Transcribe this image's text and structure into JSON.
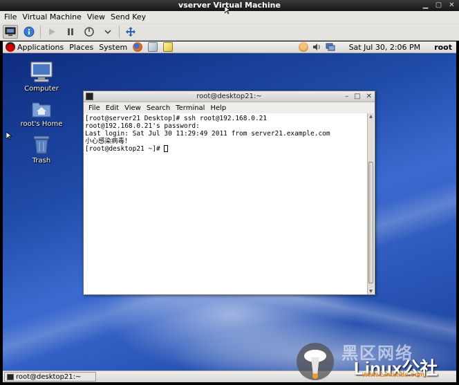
{
  "host_window": {
    "title": "vserver Virtual Machine",
    "controls": [
      "minimize-icon",
      "maximize-icon",
      "close-icon"
    ]
  },
  "host_menu": [
    "File",
    "Virtual Machine",
    "View",
    "Send Key"
  ],
  "host_toolbar": {
    "buttons": [
      "console-icon",
      "details-info-icon",
      "run-icon",
      "pause-icon",
      "shutdown-icon",
      "dropdown-chevron-icon",
      "fullscreen-icon"
    ],
    "active": "console-icon"
  },
  "gnome_panel": {
    "menus": [
      "Applications",
      "Places",
      "System"
    ],
    "launchers": [
      "firefox-icon",
      "mail-icon",
      "notes-icon"
    ],
    "tray": [
      "user-status-icon",
      "volume-icon",
      "network-icon"
    ],
    "clock": "Sat Jul 30,  2:06 PM",
    "user": "root"
  },
  "desktop_icons": [
    {
      "label": "Computer",
      "icon": "computer-icon"
    },
    {
      "label": "root's Home",
      "icon": "home-folder-icon"
    },
    {
      "label": "Trash",
      "icon": "trash-icon"
    }
  ],
  "terminal": {
    "title": "root@desktop21:~",
    "menu": [
      "File",
      "Edit",
      "View",
      "Search",
      "Terminal",
      "Help"
    ],
    "lines": [
      "[root@server21 Desktop]# ssh root@192.168.0.21",
      "root@192.168.0.21's password:",
      "Last login: Sat Jul 30 11:29:49 2011 from server21.example.com",
      "小心感染病毒！",
      "[root@desktop21 ~]# "
    ]
  },
  "taskbar": {
    "items": [
      "root@desktop21:~"
    ]
  },
  "watermark": {
    "brand_top": "黑区网络",
    "brand_main": "Linux公社",
    "brand_url": "www.Linuxidc.com"
  },
  "colors": {
    "desktop_blue": "#1f4ba8",
    "panel_bg": "#e6e4e0",
    "terminal_bg": "#ffffff",
    "watermark_orange": "#f08a1c"
  }
}
